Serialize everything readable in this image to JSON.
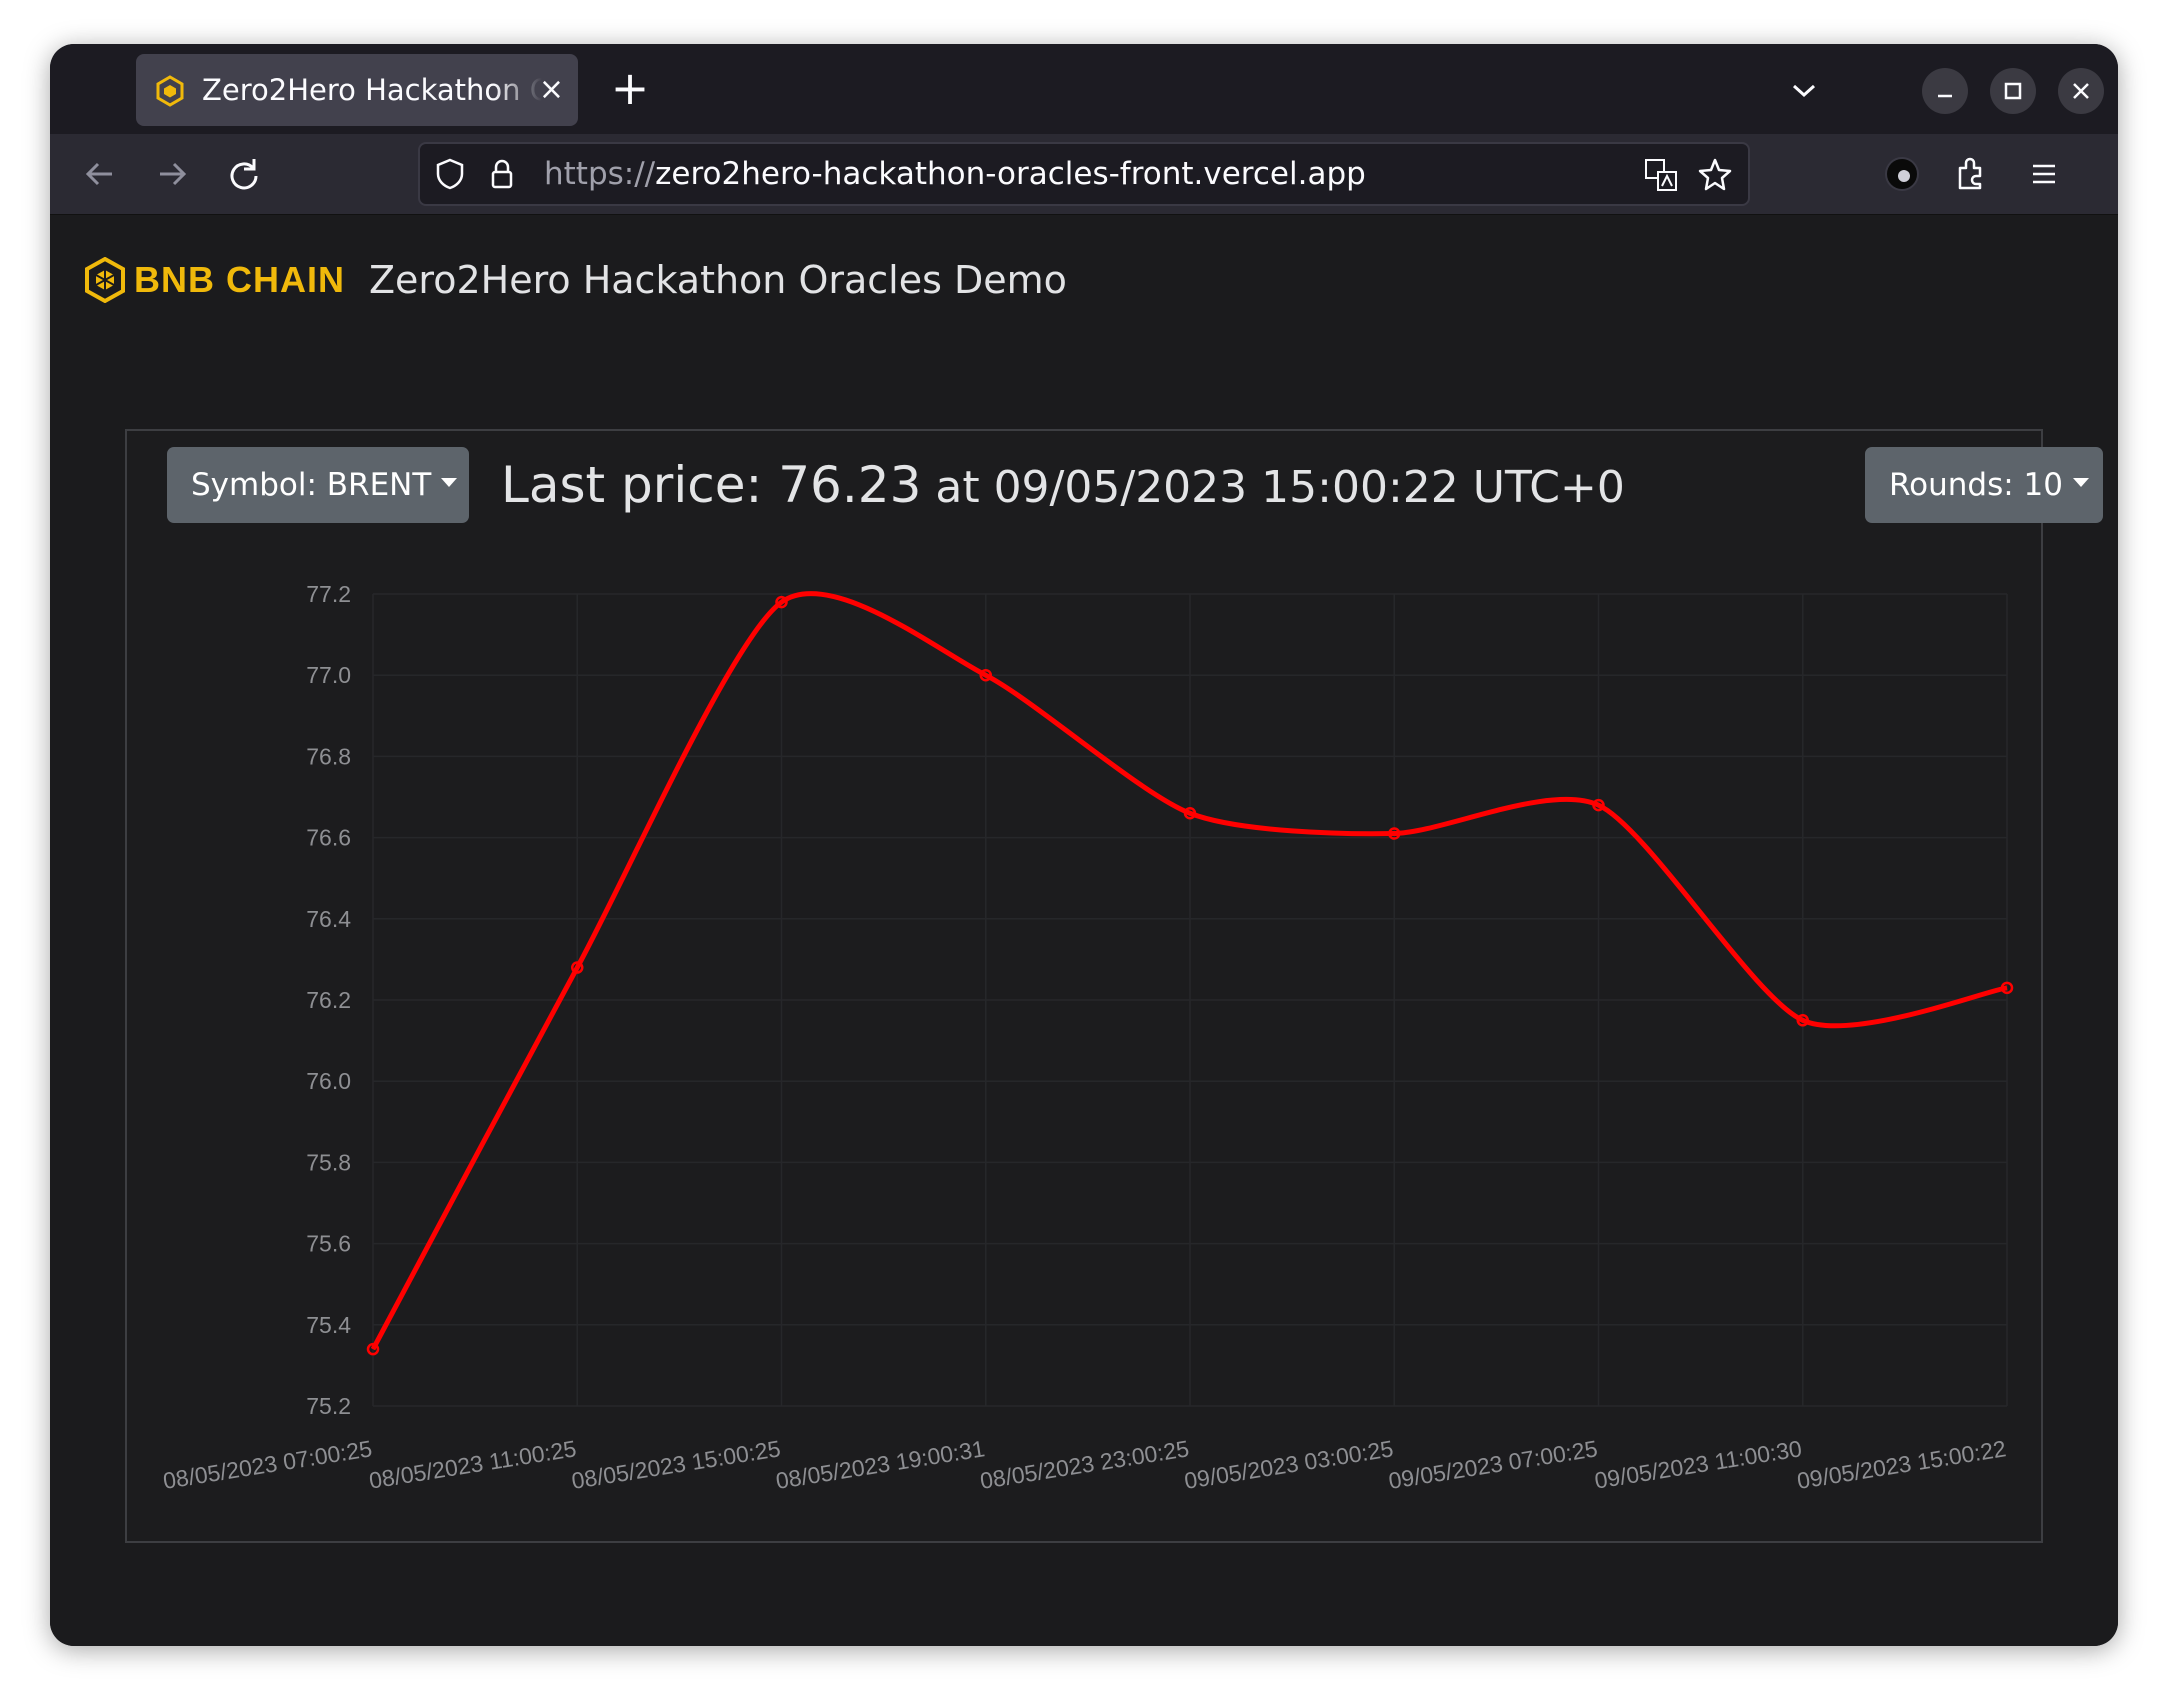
{
  "browser": {
    "tab_title": "Zero2Hero Hackathon Oracles Demo",
    "tab_close": "×",
    "new_tab": "+",
    "url_scheme": "https://",
    "url_host": "zero2hero-hackathon-oracles-front.vercel.app"
  },
  "header": {
    "brand": "BNB CHAIN",
    "title": "Zero2Hero Hackathon Oracles Demo"
  },
  "controls": {
    "symbol_label": "Symbol: BRENT",
    "rounds_label": "Rounds: 10"
  },
  "last_price": {
    "prefix": "Last price: ",
    "value": "76.23",
    "at": " at ",
    "timestamp": "09/05/2023 15:00:22 UTC+0"
  },
  "colors": {
    "accent_brand": "#f0b90b",
    "line": "#ff0000",
    "page_bg": "#1b1b1d",
    "button_bg": "#5d646b"
  },
  "chart_data": {
    "type": "line",
    "categories": [
      "08/05/2023 07:00:25",
      "08/05/2023 11:00:25",
      "08/05/2023 15:00:25",
      "08/05/2023 19:00:31",
      "08/05/2023 23:00:25",
      "09/05/2023 03:00:25",
      "09/05/2023 07:00:25",
      "09/05/2023 11:00:30",
      "09/05/2023 15:00:22"
    ],
    "series": [
      {
        "values": [
          75.34,
          76.28,
          77.18,
          77.0,
          76.66,
          76.61,
          76.68,
          76.15,
          76.23
        ]
      }
    ],
    "ylim": [
      75.2,
      77.2
    ],
    "yticks": [
      "75.2",
      "75.4",
      "75.6",
      "75.8",
      "76.0",
      "76.2",
      "76.4",
      "76.6",
      "76.8",
      "77.0",
      "77.2"
    ],
    "grid": true,
    "legend": "none"
  }
}
